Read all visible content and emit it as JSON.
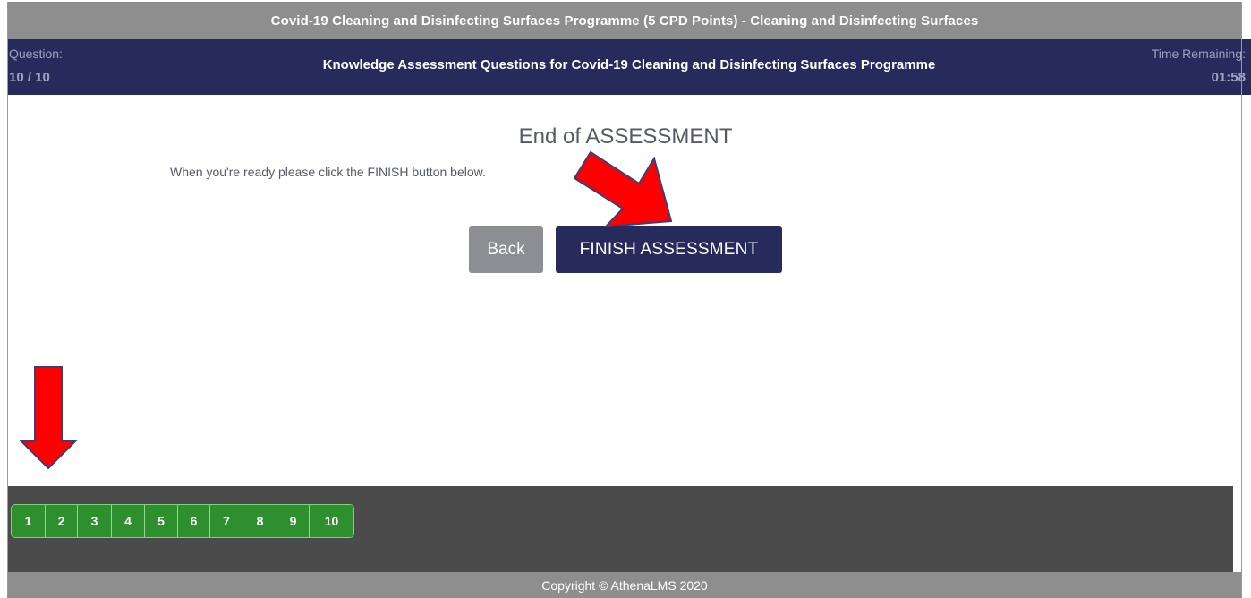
{
  "title_bar": {
    "text": "Covid-19 Cleaning and Disinfecting Surfaces Programme (5 CPD Points) - Cleaning and Disinfecting Surfaces"
  },
  "header": {
    "question_label": "Question:",
    "question_value": "10 / 10",
    "title": "Knowledge Assessment Questions for Covid-19 Cleaning and Disinfecting Surfaces Programme",
    "time_label": "Time Remaining:",
    "time_value": "01:58"
  },
  "main": {
    "heading": "End of ASSESSMENT",
    "instruction": "When you're ready please click the FINISH button below.",
    "back_label": "Back",
    "finish_label": "FINISH ASSESSMENT"
  },
  "question_nav": {
    "items": [
      "1",
      "2",
      "3",
      "4",
      "5",
      "6",
      "7",
      "8",
      "9",
      "10"
    ],
    "status": "answered",
    "color": "#2e8f2e"
  },
  "annotations": {
    "arrow_color": "#ff0000",
    "arrows": [
      "arrow-pointing-to-finish-button",
      "arrow-pointing-to-question-navigation"
    ]
  },
  "footer": {
    "copyright": "Copyright © AthenaLMS 2020"
  },
  "colors": {
    "navy": "#262b5c",
    "grey": "#8e8e8e",
    "dark_grey": "#4b4b4b"
  }
}
